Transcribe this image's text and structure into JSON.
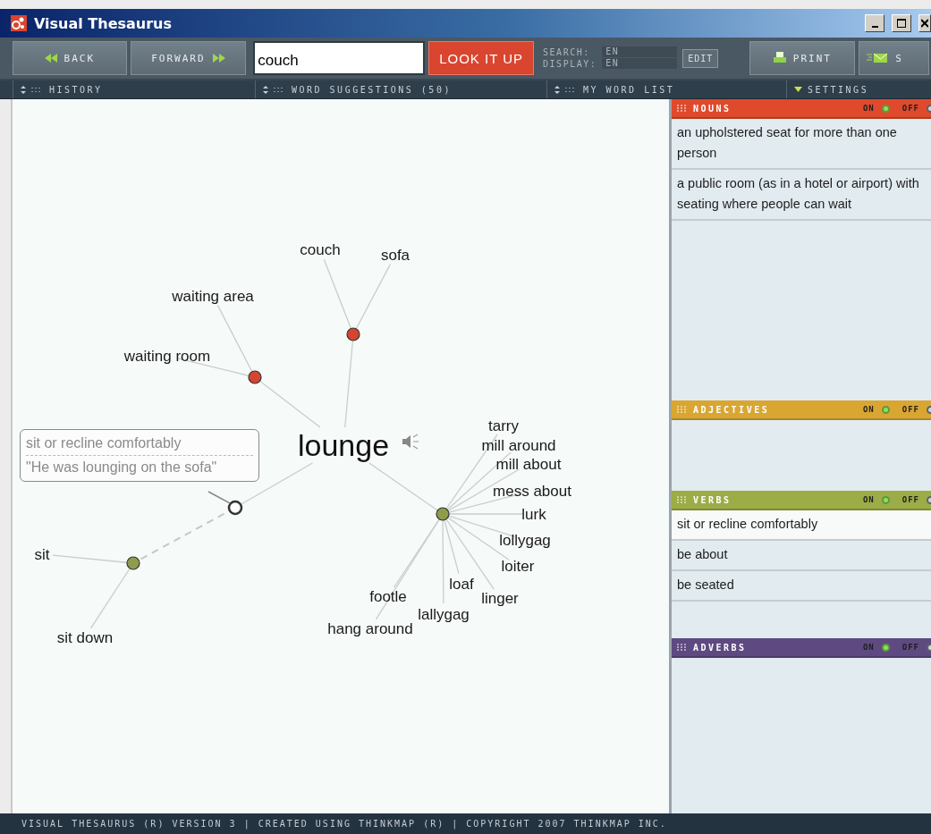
{
  "window": {
    "title": "Visual Thesaurus"
  },
  "toolbar": {
    "back": "BACK",
    "forward": "FORWARD",
    "search": {
      "value": "couch"
    },
    "lookup": "LOOK IT UP",
    "search_lang_label": "SEARCH:",
    "search_lang": "EN",
    "display_lang_label": "DISPLAY:",
    "display_lang": "EN",
    "edit": "EDIT",
    "print": "PRINT",
    "share": "S"
  },
  "panel_bar": [
    {
      "label": "HISTORY",
      "kind": "drawer"
    },
    {
      "label": "WORD SUGGESTIONS (50)",
      "kind": "drawer"
    },
    {
      "label": "MY WORD LIST",
      "kind": "drawer"
    },
    {
      "label": "SETTINGS",
      "kind": "menu"
    }
  ],
  "graph": {
    "center": "lounge",
    "meanings": [
      {
        "color": "#d64530",
        "selected": false,
        "words": [
          "couch",
          "sofa"
        ]
      },
      {
        "color": "#d64530",
        "selected": false,
        "words": [
          "waiting area",
          "waiting room"
        ]
      },
      {
        "color": "#8f9c4c",
        "selected": true,
        "words": [
          "sit",
          "sit down"
        ]
      },
      {
        "color": "#8f9c4c",
        "selected": false,
        "words": [
          "tarry",
          "mill around",
          "mill about",
          "mess about",
          "lurk",
          "lollygag",
          "loiter",
          "loaf",
          "linger",
          "footle",
          "lallygag",
          "hang around"
        ]
      }
    ],
    "tooltip": {
      "definition": "sit or recline comfortably",
      "example": "\"He was lounging on the sofa\""
    }
  },
  "sections": [
    {
      "title": "NOUNS",
      "color": "#df4a2c",
      "on": true,
      "on_label": "ON",
      "off_label": "OFF",
      "meanings": [
        {
          "text": "an upholstered seat for more than one person",
          "selected": false
        },
        {
          "text": "a public room (as in a hotel or airport) with seating where people can wait",
          "selected": false
        }
      ]
    },
    {
      "title": "ADJECTIVES",
      "color": "#d9a632",
      "on": true,
      "on_label": "ON",
      "off_label": "OFF"
    },
    {
      "title": "VERBS",
      "color": "#9cac46",
      "on": true,
      "on_label": "ON",
      "off_label": "OFF",
      "meanings": [
        {
          "text": "sit or recline comfortably",
          "selected": true
        },
        {
          "text": "be about",
          "selected": false
        },
        {
          "text": "be seated",
          "selected": false
        }
      ]
    },
    {
      "title": "ADVERBS",
      "color": "#5e4a80",
      "on": true,
      "on_label": "ON",
      "off_label": "OFF"
    }
  ],
  "status_bar": "VISUAL THESAURUS (R) VERSION 3 | CREATED USING THINKMAP (R) | COPYRIGHT 2007 THINKMAP INC."
}
